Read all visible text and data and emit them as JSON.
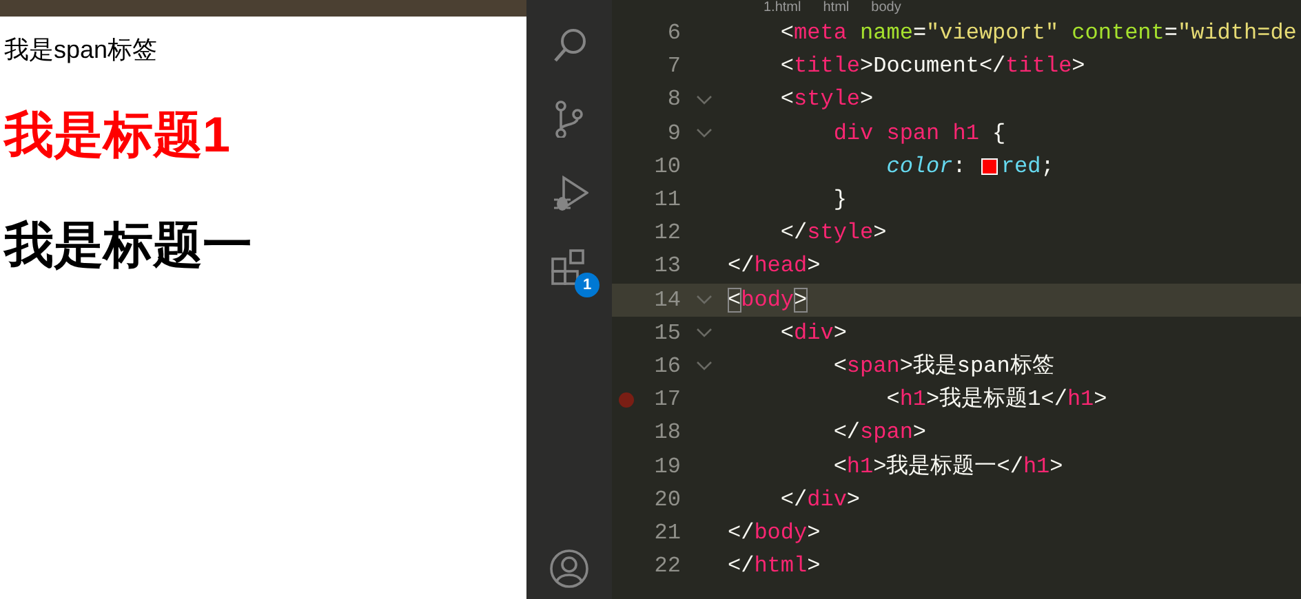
{
  "browser_page": {
    "span_text": "我是span标签",
    "headings": [
      {
        "text": "我是标题1",
        "color": "#ff0000"
      },
      {
        "text": "我是标题一",
        "color": "#000000"
      }
    ]
  },
  "editor": {
    "breadcrumb": [
      "1.html",
      "html",
      "body"
    ],
    "activity_bar": [
      {
        "kind": "search"
      },
      {
        "kind": "source-control"
      },
      {
        "kind": "run-debug"
      },
      {
        "kind": "extensions",
        "badge": "1"
      },
      {
        "kind": "account"
      }
    ],
    "lines": [
      {
        "number": "6",
        "fold": false,
        "breakpoint": false,
        "current": false,
        "tokens": [
          {
            "kind": "punct",
            "text": "    <"
          },
          {
            "kind": "tag",
            "text": "meta"
          },
          {
            "kind": "attr",
            "text": " name"
          },
          {
            "kind": "punct",
            "text": "="
          },
          {
            "kind": "string",
            "text": "\"viewport\""
          },
          {
            "kind": "attr",
            "text": " content"
          },
          {
            "kind": "punct",
            "text": "="
          },
          {
            "kind": "string",
            "text": "\"width=de"
          }
        ]
      },
      {
        "number": "7",
        "fold": false,
        "breakpoint": false,
        "current": false,
        "tokens": [
          {
            "kind": "punct",
            "text": "    <"
          },
          {
            "kind": "tag",
            "text": "title"
          },
          {
            "kind": "punct",
            "text": ">Document</"
          },
          {
            "kind": "tag",
            "text": "title"
          },
          {
            "kind": "punct",
            "text": ">"
          }
        ]
      },
      {
        "number": "8",
        "fold": true,
        "breakpoint": false,
        "current": false,
        "tokens": [
          {
            "kind": "punct",
            "text": "    <"
          },
          {
            "kind": "tag",
            "text": "style"
          },
          {
            "kind": "punct",
            "text": ">"
          }
        ]
      },
      {
        "number": "9",
        "fold": true,
        "breakpoint": false,
        "current": false,
        "tokens": [
          {
            "kind": "tag",
            "text": "        div span h1"
          },
          {
            "kind": "punct",
            "text": " {"
          }
        ]
      },
      {
        "number": "10",
        "fold": false,
        "breakpoint": false,
        "current": false,
        "tokens": [
          {
            "kind": "property",
            "text": "            color"
          },
          {
            "kind": "punct",
            "text": ": "
          },
          {
            "kind": "swatch",
            "color": "#ff0000"
          },
          {
            "kind": "value",
            "text": "red"
          },
          {
            "kind": "punct",
            "text": ";"
          }
        ]
      },
      {
        "number": "11",
        "fold": false,
        "breakpoint": false,
        "current": false,
        "tokens": [
          {
            "kind": "punct",
            "text": "        }"
          }
        ]
      },
      {
        "number": "12",
        "fold": false,
        "breakpoint": false,
        "current": false,
        "tokens": [
          {
            "kind": "punct",
            "text": "    </"
          },
          {
            "kind": "tag",
            "text": "style"
          },
          {
            "kind": "punct",
            "text": ">"
          }
        ]
      },
      {
        "number": "13",
        "fold": false,
        "breakpoint": false,
        "current": false,
        "tokens": [
          {
            "kind": "punct",
            "text": "</"
          },
          {
            "kind": "tag",
            "text": "head"
          },
          {
            "kind": "punct",
            "text": ">"
          }
        ]
      },
      {
        "number": "14",
        "fold": true,
        "breakpoint": false,
        "current": true,
        "tokens": [
          {
            "kind": "bracket",
            "text": "<"
          },
          {
            "kind": "tag",
            "text": "body"
          },
          {
            "kind": "bracket",
            "text": ">"
          }
        ]
      },
      {
        "number": "15",
        "fold": true,
        "breakpoint": false,
        "current": false,
        "tokens": [
          {
            "kind": "punct",
            "text": "    <"
          },
          {
            "kind": "tag",
            "text": "div"
          },
          {
            "kind": "punct",
            "text": ">"
          }
        ]
      },
      {
        "number": "16",
        "fold": true,
        "breakpoint": false,
        "current": false,
        "tokens": [
          {
            "kind": "punct",
            "text": "        <"
          },
          {
            "kind": "tag",
            "text": "span"
          },
          {
            "kind": "punct",
            "text": ">我是span标签"
          }
        ]
      },
      {
        "number": "17",
        "fold": false,
        "breakpoint": true,
        "current": false,
        "tokens": [
          {
            "kind": "punct",
            "text": "            <"
          },
          {
            "kind": "tag",
            "text": "h1"
          },
          {
            "kind": "punct",
            "text": ">我是标题1</"
          },
          {
            "kind": "tag",
            "text": "h1"
          },
          {
            "kind": "punct",
            "text": ">"
          }
        ]
      },
      {
        "number": "18",
        "fold": false,
        "breakpoint": false,
        "current": false,
        "tokens": [
          {
            "kind": "punct",
            "text": "        </"
          },
          {
            "kind": "tag",
            "text": "span"
          },
          {
            "kind": "punct",
            "text": ">"
          }
        ]
      },
      {
        "number": "19",
        "fold": false,
        "breakpoint": false,
        "current": false,
        "tokens": [
          {
            "kind": "punct",
            "text": "        <"
          },
          {
            "kind": "tag",
            "text": "h1"
          },
          {
            "kind": "punct",
            "text": ">我是标题一</"
          },
          {
            "kind": "tag",
            "text": "h1"
          },
          {
            "kind": "punct",
            "text": ">"
          }
        ]
      },
      {
        "number": "20",
        "fold": false,
        "breakpoint": false,
        "current": false,
        "tokens": [
          {
            "kind": "punct",
            "text": "    </"
          },
          {
            "kind": "tag",
            "text": "div"
          },
          {
            "kind": "punct",
            "text": ">"
          }
        ]
      },
      {
        "number": "21",
        "fold": false,
        "breakpoint": false,
        "current": false,
        "tokens": [
          {
            "kind": "punct",
            "text": "</"
          },
          {
            "kind": "tag",
            "text": "body"
          },
          {
            "kind": "punct",
            "text": ">"
          }
        ]
      },
      {
        "number": "22",
        "fold": false,
        "breakpoint": false,
        "current": false,
        "tokens": [
          {
            "kind": "punct",
            "text": "</"
          },
          {
            "kind": "tag",
            "text": "html"
          },
          {
            "kind": "punct",
            "text": ">"
          }
        ]
      }
    ]
  }
}
